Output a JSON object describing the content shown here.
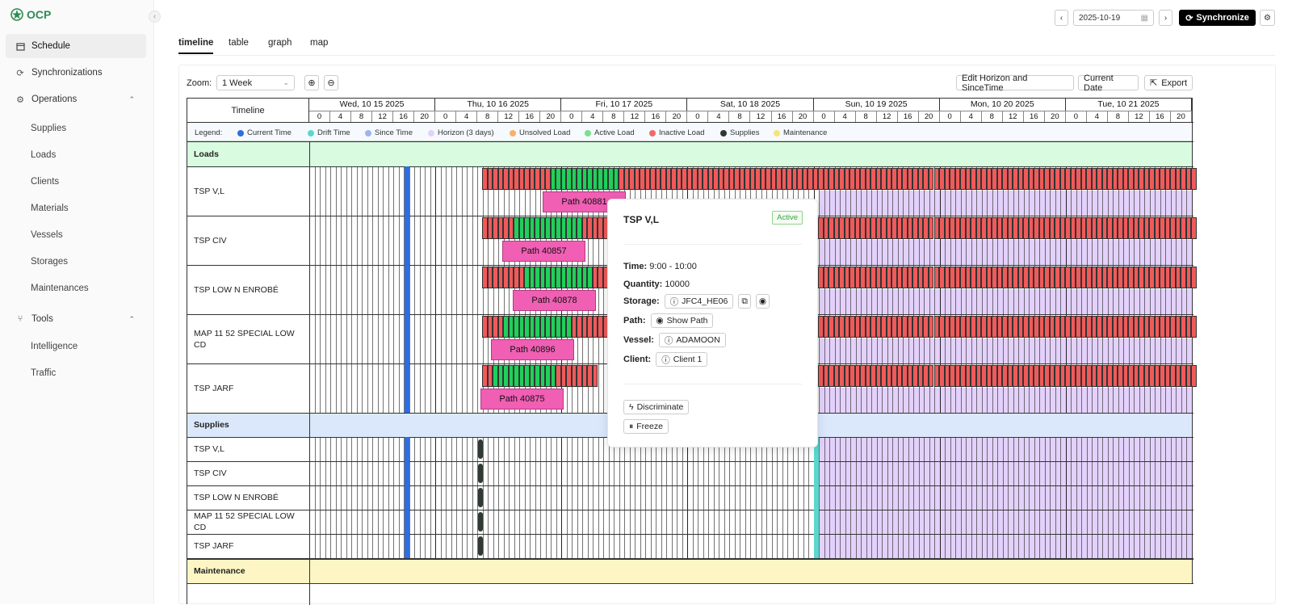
{
  "brand": {
    "logo_text": "OCP"
  },
  "sidebar": {
    "items": [
      {
        "label": "Schedule",
        "icon": "calendar-icon"
      },
      {
        "label": "Synchronizations",
        "icon": "sync-icon"
      },
      {
        "label": "Operations",
        "icon": "gear-icon"
      },
      {
        "label": "Tools",
        "icon": "branch-icon"
      }
    ],
    "operations_sub": [
      "Supplies",
      "Loads",
      "Clients",
      "Materials",
      "Vessels",
      "Storages",
      "Maintenances"
    ],
    "tools_sub": [
      "Intelligence",
      "Traffic"
    ]
  },
  "header": {
    "date_value": "2025-10-19",
    "sync_label": "Synchronize"
  },
  "tabs": [
    "timeline",
    "table",
    "graph",
    "map"
  ],
  "toolbar": {
    "zoom_label": "Zoom:",
    "zoom_value": "1 Week",
    "edit_label": "Edit Horizon and SinceTime",
    "current_label": "Current Date",
    "export_label": "Export"
  },
  "grid": {
    "corner_label": "Timeline",
    "days": [
      "Wed, 10 15 2025",
      "Thu, 10 16 2025",
      "Fri, 10 17 2025",
      "Sat, 10 18 2025",
      "Sun, 10 19 2025",
      "Mon, 10 20 2025",
      "Tue, 10 21 2025"
    ],
    "hours": [
      "0",
      "4",
      "8",
      "12",
      "16",
      "20"
    ],
    "legend_title": "Legend:",
    "legend": [
      {
        "label": "Current Time",
        "color": "#2d6ee0"
      },
      {
        "label": "Drift Time",
        "color": "#5ad8cf"
      },
      {
        "label": "Since Time",
        "color": "#9fb3ee"
      },
      {
        "label": "Horizon (3 days)",
        "color": "#e3d1fb"
      },
      {
        "label": "Unsolved Load",
        "color": "#f7b267"
      },
      {
        "label": "Active Load",
        "color": "#7be08f"
      },
      {
        "label": "Inactive Load",
        "color": "#f26a6a"
      },
      {
        "label": "Supplies",
        "color": "#2f3a32"
      },
      {
        "label": "Maintenance",
        "color": "#f6e27a"
      }
    ],
    "sections": {
      "loads": "Loads",
      "supplies": "Supplies",
      "maintenance": "Maintenance"
    },
    "load_rows": [
      "TSP V,L",
      "TSP CIV",
      "TSP LOW N ENROBÉ",
      "MAP 11 52 SPECIAL LOW CD",
      "TSP JARF"
    ],
    "supply_rows": [
      "TSP V,L",
      "TSP CIV",
      "TSP LOW N ENROBÉ",
      "MAP 11 52 SPECIAL LOW CD",
      "TSP JARF"
    ],
    "paths": [
      "Path 40881",
      "Path 40857",
      "Path 40878",
      "Path 40896",
      "Path 40875"
    ]
  },
  "popup": {
    "title": "TSP V,L",
    "status": "Active",
    "time_label": "Time:",
    "time_value": "9:00 - 10:00",
    "qty_label": "Quantity:",
    "qty_value": "10000",
    "storage_label": "Storage:",
    "storage_value": "JFC4_HE06",
    "path_label": "Path:",
    "path_value": "Show Path",
    "vessel_label": "Vessel:",
    "vessel_value": "ADAMOON",
    "client_label": "Client:",
    "client_value": "Client 1",
    "discriminate_label": "Discriminate",
    "freeze_label": "Freeze"
  },
  "colors": {
    "active": "#1fd05a",
    "inactive": "#f05a5a",
    "horizon": "#e3d1fb",
    "current": "#2d6ee0",
    "drift": "#5ad8cf",
    "supply": "#2f3a32",
    "path": "#f05fb3"
  }
}
